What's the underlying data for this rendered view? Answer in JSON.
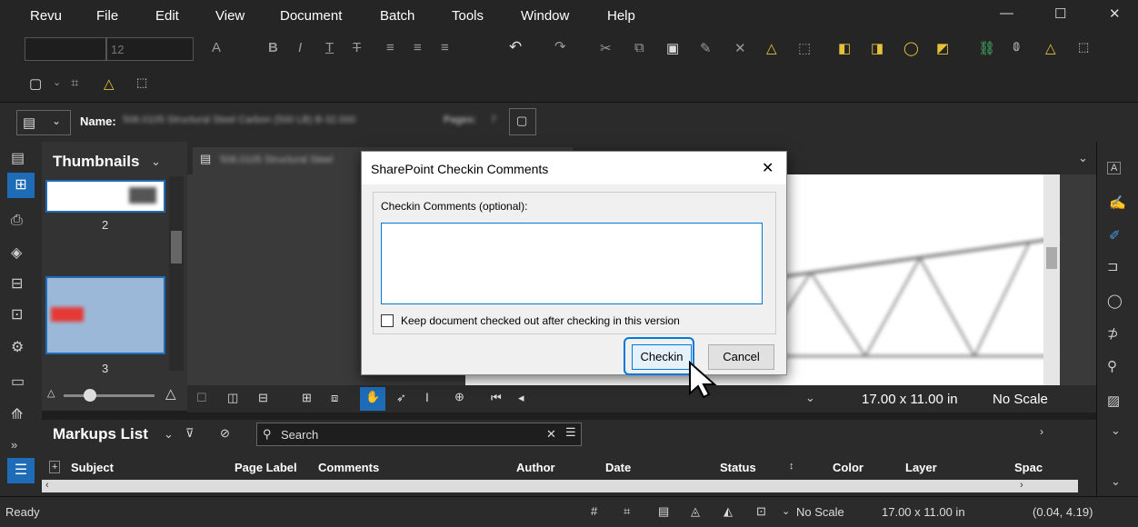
{
  "menu": {
    "items": [
      "Revu",
      "File",
      "Edit",
      "View",
      "Document",
      "Batch",
      "Tools",
      "Window",
      "Help"
    ],
    "minimize": "—",
    "maximize": "☐",
    "close": "✕"
  },
  "toolbar": {
    "font_size": "12"
  },
  "doc": {
    "name_label": "Name:",
    "name_value": "506.0105 Structural Steel Carbon (500 LB) B-32.000",
    "pages_label": "Pages:",
    "pages_value": "7",
    "tab_name": "506.0105 Structural Steel"
  },
  "thumbnails": {
    "title": "Thumbnails",
    "page2": "2",
    "page3": "3"
  },
  "view": {
    "size": "17.00 x 11.00 in",
    "scale": "No Scale"
  },
  "markups": {
    "title": "Markups List",
    "search_placeholder": "Search",
    "columns": [
      "Subject",
      "Page Label",
      "Comments",
      "Author",
      "Date",
      "Status",
      "Color",
      "Layer",
      "Spac"
    ]
  },
  "status": {
    "ready": "Ready",
    "scale": "No Scale",
    "size": "17.00 x 11.00 in",
    "coords": "(0.04, 4.19)"
  },
  "dialog": {
    "title": "SharePoint Checkin Comments",
    "group_label": "Checkin Comments (optional):",
    "comment_value": "",
    "keep_label": "Keep document checked out after checking in this version",
    "checkin": "Checkin",
    "cancel": "Cancel"
  },
  "colors": {
    "accent": "#1e6bb8",
    "focus": "#0078d7",
    "red": "#e53935"
  }
}
